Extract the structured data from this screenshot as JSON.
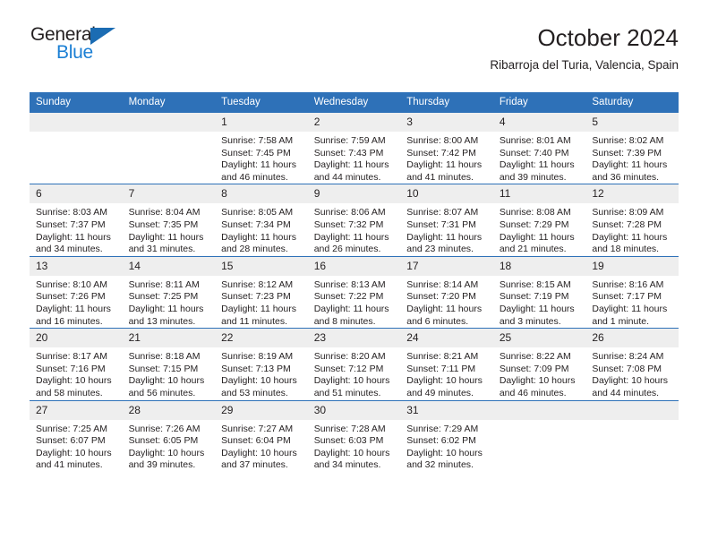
{
  "brand": {
    "name_part1": "General",
    "name_part2": "Blue",
    "triangle_color": "#1b6cb3",
    "blue_color": "#1b7fd4"
  },
  "header": {
    "title": "October 2024",
    "subtitle": "Ribarroja del Turia, Valencia, Spain"
  },
  "theme": {
    "header_blue": "#2e71b8",
    "daynum_band": "#eeeeee",
    "text": "#231f20"
  },
  "calendar": {
    "weekday_headers": [
      "Sunday",
      "Monday",
      "Tuesday",
      "Wednesday",
      "Thursday",
      "Friday",
      "Saturday"
    ],
    "weeks": [
      [
        {
          "day": "",
          "sunrise": "",
          "sunset": "",
          "daylight": "",
          "blank": true
        },
        {
          "day": "",
          "sunrise": "",
          "sunset": "",
          "daylight": "",
          "blank": true
        },
        {
          "day": "1",
          "sunrise": "Sunrise: 7:58 AM",
          "sunset": "Sunset: 7:45 PM",
          "daylight": "Daylight: 11 hours and 46 minutes."
        },
        {
          "day": "2",
          "sunrise": "Sunrise: 7:59 AM",
          "sunset": "Sunset: 7:43 PM",
          "daylight": "Daylight: 11 hours and 44 minutes."
        },
        {
          "day": "3",
          "sunrise": "Sunrise: 8:00 AM",
          "sunset": "Sunset: 7:42 PM",
          "daylight": "Daylight: 11 hours and 41 minutes."
        },
        {
          "day": "4",
          "sunrise": "Sunrise: 8:01 AM",
          "sunset": "Sunset: 7:40 PM",
          "daylight": "Daylight: 11 hours and 39 minutes."
        },
        {
          "day": "5",
          "sunrise": "Sunrise: 8:02 AM",
          "sunset": "Sunset: 7:39 PM",
          "daylight": "Daylight: 11 hours and 36 minutes."
        }
      ],
      [
        {
          "day": "6",
          "sunrise": "Sunrise: 8:03 AM",
          "sunset": "Sunset: 7:37 PM",
          "daylight": "Daylight: 11 hours and 34 minutes."
        },
        {
          "day": "7",
          "sunrise": "Sunrise: 8:04 AM",
          "sunset": "Sunset: 7:35 PM",
          "daylight": "Daylight: 11 hours and 31 minutes."
        },
        {
          "day": "8",
          "sunrise": "Sunrise: 8:05 AM",
          "sunset": "Sunset: 7:34 PM",
          "daylight": "Daylight: 11 hours and 28 minutes."
        },
        {
          "day": "9",
          "sunrise": "Sunrise: 8:06 AM",
          "sunset": "Sunset: 7:32 PM",
          "daylight": "Daylight: 11 hours and 26 minutes."
        },
        {
          "day": "10",
          "sunrise": "Sunrise: 8:07 AM",
          "sunset": "Sunset: 7:31 PM",
          "daylight": "Daylight: 11 hours and 23 minutes."
        },
        {
          "day": "11",
          "sunrise": "Sunrise: 8:08 AM",
          "sunset": "Sunset: 7:29 PM",
          "daylight": "Daylight: 11 hours and 21 minutes."
        },
        {
          "day": "12",
          "sunrise": "Sunrise: 8:09 AM",
          "sunset": "Sunset: 7:28 PM",
          "daylight": "Daylight: 11 hours and 18 minutes."
        }
      ],
      [
        {
          "day": "13",
          "sunrise": "Sunrise: 8:10 AM",
          "sunset": "Sunset: 7:26 PM",
          "daylight": "Daylight: 11 hours and 16 minutes."
        },
        {
          "day": "14",
          "sunrise": "Sunrise: 8:11 AM",
          "sunset": "Sunset: 7:25 PM",
          "daylight": "Daylight: 11 hours and 13 minutes."
        },
        {
          "day": "15",
          "sunrise": "Sunrise: 8:12 AM",
          "sunset": "Sunset: 7:23 PM",
          "daylight": "Daylight: 11 hours and 11 minutes."
        },
        {
          "day": "16",
          "sunrise": "Sunrise: 8:13 AM",
          "sunset": "Sunset: 7:22 PM",
          "daylight": "Daylight: 11 hours and 8 minutes."
        },
        {
          "day": "17",
          "sunrise": "Sunrise: 8:14 AM",
          "sunset": "Sunset: 7:20 PM",
          "daylight": "Daylight: 11 hours and 6 minutes."
        },
        {
          "day": "18",
          "sunrise": "Sunrise: 8:15 AM",
          "sunset": "Sunset: 7:19 PM",
          "daylight": "Daylight: 11 hours and 3 minutes."
        },
        {
          "day": "19",
          "sunrise": "Sunrise: 8:16 AM",
          "sunset": "Sunset: 7:17 PM",
          "daylight": "Daylight: 11 hours and 1 minute."
        }
      ],
      [
        {
          "day": "20",
          "sunrise": "Sunrise: 8:17 AM",
          "sunset": "Sunset: 7:16 PM",
          "daylight": "Daylight: 10 hours and 58 minutes."
        },
        {
          "day": "21",
          "sunrise": "Sunrise: 8:18 AM",
          "sunset": "Sunset: 7:15 PM",
          "daylight": "Daylight: 10 hours and 56 minutes."
        },
        {
          "day": "22",
          "sunrise": "Sunrise: 8:19 AM",
          "sunset": "Sunset: 7:13 PM",
          "daylight": "Daylight: 10 hours and 53 minutes."
        },
        {
          "day": "23",
          "sunrise": "Sunrise: 8:20 AM",
          "sunset": "Sunset: 7:12 PM",
          "daylight": "Daylight: 10 hours and 51 minutes."
        },
        {
          "day": "24",
          "sunrise": "Sunrise: 8:21 AM",
          "sunset": "Sunset: 7:11 PM",
          "daylight": "Daylight: 10 hours and 49 minutes."
        },
        {
          "day": "25",
          "sunrise": "Sunrise: 8:22 AM",
          "sunset": "Sunset: 7:09 PM",
          "daylight": "Daylight: 10 hours and 46 minutes."
        },
        {
          "day": "26",
          "sunrise": "Sunrise: 8:24 AM",
          "sunset": "Sunset: 7:08 PM",
          "daylight": "Daylight: 10 hours and 44 minutes."
        }
      ],
      [
        {
          "day": "27",
          "sunrise": "Sunrise: 7:25 AM",
          "sunset": "Sunset: 6:07 PM",
          "daylight": "Daylight: 10 hours and 41 minutes."
        },
        {
          "day": "28",
          "sunrise": "Sunrise: 7:26 AM",
          "sunset": "Sunset: 6:05 PM",
          "daylight": "Daylight: 10 hours and 39 minutes."
        },
        {
          "day": "29",
          "sunrise": "Sunrise: 7:27 AM",
          "sunset": "Sunset: 6:04 PM",
          "daylight": "Daylight: 10 hours and 37 minutes."
        },
        {
          "day": "30",
          "sunrise": "Sunrise: 7:28 AM",
          "sunset": "Sunset: 6:03 PM",
          "daylight": "Daylight: 10 hours and 34 minutes."
        },
        {
          "day": "31",
          "sunrise": "Sunrise: 7:29 AM",
          "sunset": "Sunset: 6:02 PM",
          "daylight": "Daylight: 10 hours and 32 minutes."
        },
        {
          "day": "",
          "sunrise": "",
          "sunset": "",
          "daylight": "",
          "blank": true
        },
        {
          "day": "",
          "sunrise": "",
          "sunset": "",
          "daylight": "",
          "blank": true
        }
      ]
    ]
  }
}
